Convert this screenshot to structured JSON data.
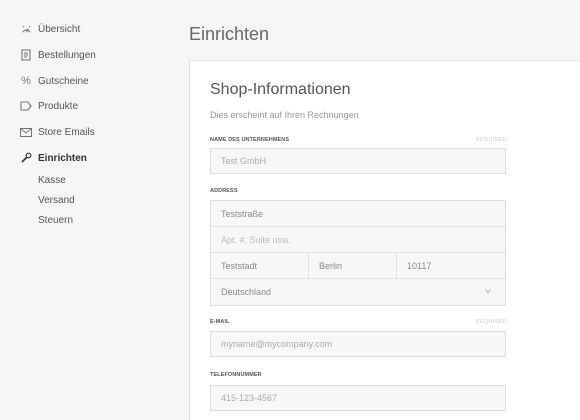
{
  "sidebar": {
    "items": [
      {
        "label": "Übersicht",
        "icon": "dashboard-icon"
      },
      {
        "label": "Bestellungen",
        "icon": "document-icon"
      },
      {
        "label": "Gutscheine",
        "icon": "percent-icon"
      },
      {
        "label": "Produkte",
        "icon": "tag-icon"
      },
      {
        "label": "Store Emails",
        "icon": "envelope-icon"
      },
      {
        "label": "Einrichten",
        "icon": "wrench-icon"
      }
    ],
    "subitems": [
      "Kasse",
      "Versand",
      "Steuern"
    ]
  },
  "header": {
    "title": "Einrichten"
  },
  "card": {
    "title": "Shop-Informationen",
    "subtitle": "Dies erscheint auf Ihren Rechnungen",
    "company": {
      "label": "NAME DES UNTERNEHMENS",
      "required": "REQUIRED",
      "placeholder": "Test GmbH"
    },
    "address": {
      "label": "ADDRESS",
      "street": "Teststraße",
      "apt_placeholder": "Apt. #, Suite usw.",
      "city": "Teststadt",
      "state": "Berlin",
      "zip": "10117",
      "country": "Deutschland"
    },
    "email": {
      "label": "E-MAIL",
      "required": "REQUIRED",
      "placeholder": "myname@mycompany.com"
    },
    "phone": {
      "label": "TELEFONNUMMER",
      "placeholder": "415-123-4567"
    }
  }
}
